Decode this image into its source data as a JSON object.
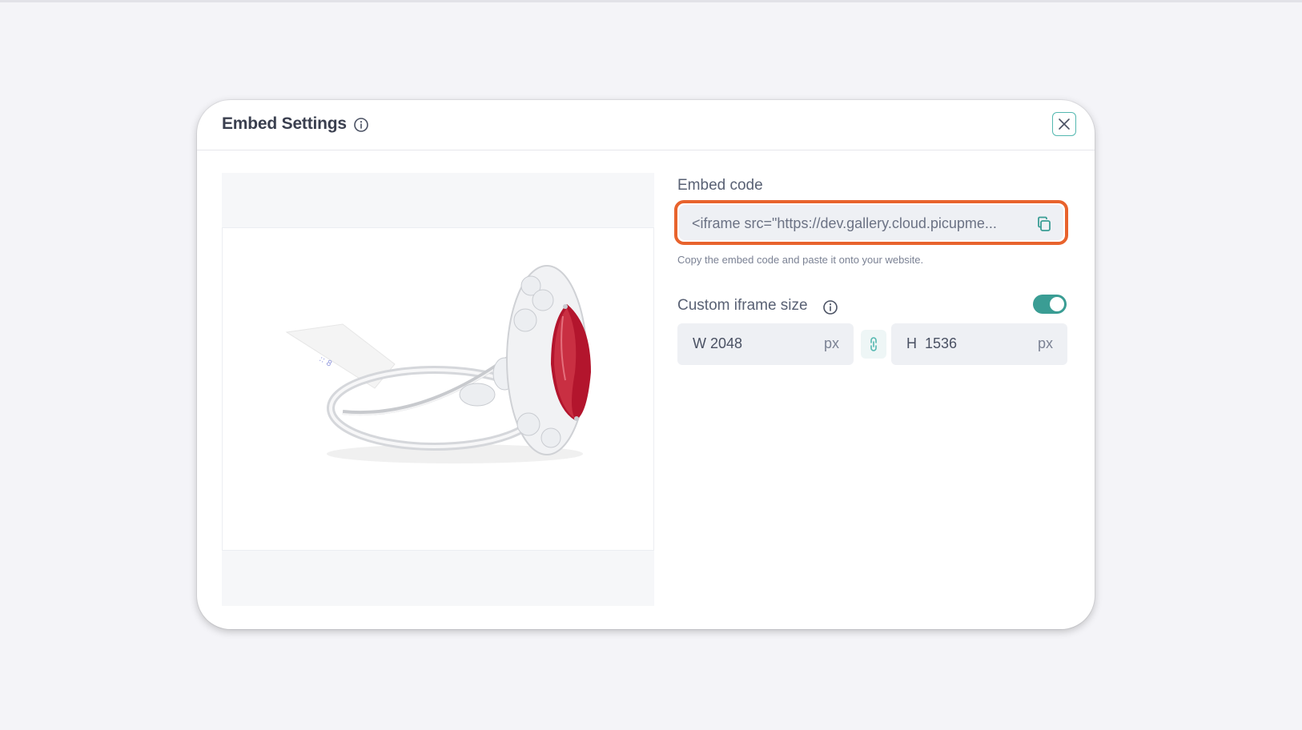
{
  "modal": {
    "title": "Embed Settings"
  },
  "preview": {
    "image_description_icon": "ring-with-red-gemstone-image"
  },
  "embed": {
    "label": "Embed code",
    "code": "<iframe src=\"https://dev.gallery.cloud.picupme...",
    "help_text": "Copy the embed code and paste it onto your website."
  },
  "custom_size": {
    "label": "Custom iframe size",
    "enabled": true,
    "width": {
      "prefix": "W",
      "value": "2048",
      "unit": "px"
    },
    "height": {
      "prefix": "H",
      "value": "1536",
      "unit": "px"
    }
  },
  "colors": {
    "accent_teal": "#3a9d94",
    "highlight_orange": "#e8632d",
    "text_dark": "#3a3f4f"
  }
}
